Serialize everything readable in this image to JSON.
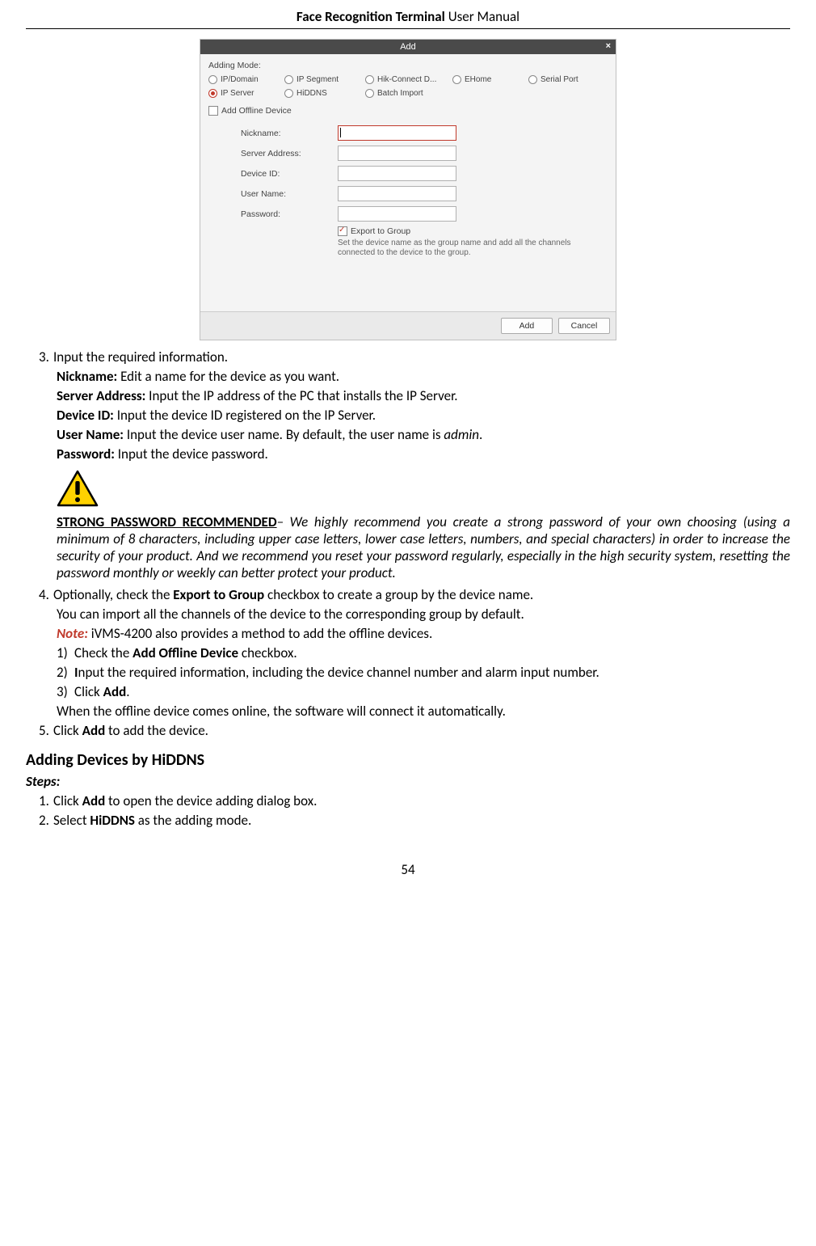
{
  "header": {
    "title_bold": "Face Recognition Terminal",
    "title_plain": "  User Manual"
  },
  "page_number": "54",
  "dialog": {
    "title": "Add",
    "close": "×",
    "mode_label": "Adding Mode:",
    "radios_row1": [
      "IP/Domain",
      "IP Segment",
      "Hik-Connect D...",
      "EHome",
      "Serial Port"
    ],
    "radios_row2": [
      "IP Server",
      "HiDDNS",
      "Batch Import"
    ],
    "selected_radio": "IP Server",
    "add_offline": "Add Offline Device",
    "fields": {
      "nickname": "Nickname:",
      "server": "Server Address:",
      "device_id": "Device ID:",
      "user_name": "User Name:",
      "password": "Password:"
    },
    "export_check": "Export to Group",
    "export_note": "Set the device name as the group name and add all the channels connected to the device to the group.",
    "btn_add": "Add",
    "btn_cancel": "Cancel"
  },
  "step3": {
    "num": "3.",
    "intro": "Input the required information.",
    "nickname_l": "Nickname:",
    "nickname_t": " Edit a name for the device as you want.",
    "server_l": "Server Address:",
    "server_t": " Input the IP address of the PC that installs the IP Server.",
    "device_l": "Device ID:",
    "device_t": " Input the device ID registered on the IP Server.",
    "user_l": "User Name:",
    "user_p1": " Input the device user name. By default, the user name is ",
    "user_i": "admin",
    "user_p2": ".",
    "pass_l": "Password:",
    "pass_t": " Input the device password."
  },
  "warning": {
    "heading": "STRONG PASSWORD RECOMMENDED",
    "body": "– We highly recommend you create a strong password of your own choosing (using a minimum of 8 characters, including upper case letters, lower case letters, numbers, and special characters) in order to increase the security of your product. And we recommend you reset your password regularly, especially in the high security system, resetting the password monthly or weekly can better protect your product."
  },
  "step4": {
    "num": "4.",
    "p1a": "Optionally, check the ",
    "p1b": "Export to Group",
    "p1c": " checkbox to create a group by the device name.",
    "p2": "You can import all the channels of the device to the corresponding group by default.",
    "note_l": "Note:",
    "note_t": " iVMS-4200 also provides a method to add the offline devices.",
    "s1n": "1)",
    "s1a": "Check the ",
    "s1b": "Add Offline Device",
    "s1c": " checkbox.",
    "s2n": "2)",
    "s2a": "I",
    "s2b": "nput the required information, including the device channel number and alarm input number.",
    "s3n": "3)",
    "s3a": "Click ",
    "s3b": "Add",
    "s3c": ".",
    "p3": "When the offline device comes online, the software will connect it automatically."
  },
  "step5": {
    "num": "5.",
    "a": "Click ",
    "b": "Add",
    "c": " to add the device."
  },
  "section": {
    "heading": "Adding Devices by HiDDNS",
    "steps_l": "Steps:",
    "s1n": "1.",
    "s1a": "Click ",
    "s1b": "Add",
    "s1c": " to open the device adding dialog box.",
    "s2n": "2.",
    "s2a": "Select ",
    "s2b": "HiDDNS",
    "s2c": " as the adding mode."
  }
}
